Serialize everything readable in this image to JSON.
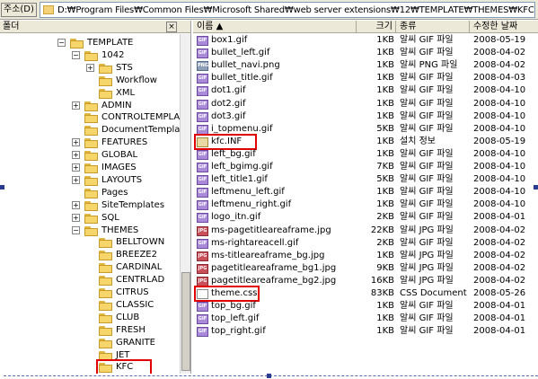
{
  "address_bar": {
    "label": "주소(D)",
    "path": "D:₩Program Files₩Common Files₩Microsoft Shared₩web server extensions₩12₩TEMPLATE₩THEMES₩KFC"
  },
  "folder_pane": {
    "title": "폴더",
    "close_glyph": "×",
    "items": [
      {
        "label": "TEMPLATE",
        "expander": "−",
        "highlighted": false
      },
      {
        "label": "1042",
        "expander": "−",
        "highlighted": false
      },
      {
        "label": "STS",
        "expander": "+",
        "highlighted": false
      },
      {
        "label": "Workflow",
        "expander": "",
        "highlighted": false
      },
      {
        "label": "XML",
        "expander": "",
        "highlighted": false
      },
      {
        "label": "ADMIN",
        "expander": "+",
        "highlighted": false
      },
      {
        "label": "CONTROLTEMPLA",
        "expander": "",
        "highlighted": false
      },
      {
        "label": "DocumentTemplate",
        "expander": "",
        "highlighted": false
      },
      {
        "label": "FEATURES",
        "expander": "+",
        "highlighted": false
      },
      {
        "label": "GLOBAL",
        "expander": "+",
        "highlighted": false
      },
      {
        "label": "IMAGES",
        "expander": "+",
        "highlighted": false
      },
      {
        "label": "LAYOUTS",
        "expander": "+",
        "highlighted": false
      },
      {
        "label": "Pages",
        "expander": "",
        "highlighted": false
      },
      {
        "label": "SiteTemplates",
        "expander": "+",
        "highlighted": false
      },
      {
        "label": "SQL",
        "expander": "+",
        "highlighted": false
      },
      {
        "label": "THEMES",
        "expander": "−",
        "highlighted": false
      },
      {
        "label": "BELLTOWN",
        "expander": "",
        "highlighted": false
      },
      {
        "label": "BREEZE2",
        "expander": "",
        "highlighted": false
      },
      {
        "label": "CARDINAL",
        "expander": "",
        "highlighted": false
      },
      {
        "label": "CENTRLAD",
        "expander": "",
        "highlighted": false
      },
      {
        "label": "CITRUS",
        "expander": "",
        "highlighted": false
      },
      {
        "label": "CLASSIC",
        "expander": "",
        "highlighted": false
      },
      {
        "label": "CLUB",
        "expander": "",
        "highlighted": false
      },
      {
        "label": "FRESH",
        "expander": "",
        "highlighted": false
      },
      {
        "label": "GRANITE",
        "expander": "",
        "highlighted": false
      },
      {
        "label": "JET",
        "expander": "",
        "highlighted": false
      },
      {
        "label": "KFC",
        "expander": "",
        "highlighted": true
      }
    ]
  },
  "file_list": {
    "columns": [
      "이름 ▲",
      "크기",
      "종류",
      "수정한 날짜"
    ],
    "rows": [
      {
        "name": "box1.gif",
        "size": "1KB",
        "type": "알씨 GIF 파일",
        "date": "2008-05-19",
        "icon": "gif",
        "highlighted": false
      },
      {
        "name": "bullet_left.gif",
        "size": "1KB",
        "type": "알씨 GIF 파일",
        "date": "2008-04-02",
        "icon": "gif",
        "highlighted": false
      },
      {
        "name": "bullet_navi.png",
        "size": "1KB",
        "type": "알씨 PNG 파일",
        "date": "2008-04-02",
        "icon": "png",
        "highlighted": false
      },
      {
        "name": "bullet_title.gif",
        "size": "1KB",
        "type": "알씨 GIF 파일",
        "date": "2008-04-03",
        "icon": "gif",
        "highlighted": false
      },
      {
        "name": "dot1.gif",
        "size": "1KB",
        "type": "알씨 GIF 파일",
        "date": "2008-04-10",
        "icon": "gif",
        "highlighted": false
      },
      {
        "name": "dot2.gif",
        "size": "1KB",
        "type": "알씨 GIF 파일",
        "date": "2008-04-10",
        "icon": "gif",
        "highlighted": false
      },
      {
        "name": "dot3.gif",
        "size": "1KB",
        "type": "알씨 GIF 파일",
        "date": "2008-04-10",
        "icon": "gif",
        "highlighted": false
      },
      {
        "name": "i_topmenu.gif",
        "size": "5KB",
        "type": "알씨 GIF 파일",
        "date": "2008-04-10",
        "icon": "gif",
        "highlighted": false
      },
      {
        "name": "kfc.INF",
        "size": "1KB",
        "type": "설치 정보",
        "date": "2008-05-19",
        "icon": "inf",
        "highlighted": true
      },
      {
        "name": "left_bg.gif",
        "size": "1KB",
        "type": "알씨 GIF 파일",
        "date": "2008-04-10",
        "icon": "gif",
        "highlighted": false
      },
      {
        "name": "left_bgimg.gif",
        "size": "7KB",
        "type": "알씨 GIF 파일",
        "date": "2008-04-10",
        "icon": "gif",
        "highlighted": false
      },
      {
        "name": "left_title1.gif",
        "size": "5KB",
        "type": "알씨 GIF 파일",
        "date": "2008-04-10",
        "icon": "gif",
        "highlighted": false
      },
      {
        "name": "leftmenu_left.gif",
        "size": "1KB",
        "type": "알씨 GIF 파일",
        "date": "2008-04-10",
        "icon": "gif",
        "highlighted": false
      },
      {
        "name": "leftmenu_right.gif",
        "size": "1KB",
        "type": "알씨 GIF 파일",
        "date": "2008-04-10",
        "icon": "gif",
        "highlighted": false
      },
      {
        "name": "logo_itn.gif",
        "size": "2KB",
        "type": "알씨 GIF 파일",
        "date": "2008-04-01",
        "icon": "gif",
        "highlighted": false
      },
      {
        "name": "ms-pagetitleareaframe.jpg",
        "size": "22KB",
        "type": "알씨 JPG 파일",
        "date": "2008-04-02",
        "icon": "jpg",
        "highlighted": false
      },
      {
        "name": "ms-rightareacell.gif",
        "size": "2KB",
        "type": "알씨 GIF 파일",
        "date": "2008-04-02",
        "icon": "gif",
        "highlighted": false
      },
      {
        "name": "ms-titleareaframe_bg.jpg",
        "size": "1KB",
        "type": "알씨 JPG 파일",
        "date": "2008-04-02",
        "icon": "jpg",
        "highlighted": false
      },
      {
        "name": "pagetitleareaframe_bg1.jpg",
        "size": "9KB",
        "type": "알씨 JPG 파일",
        "date": "2008-04-02",
        "icon": "jpg",
        "highlighted": false
      },
      {
        "name": "pagetitleareaframe_bg2.jpg",
        "size": "16KB",
        "type": "알씨 JPG 파일",
        "date": "2008-04-02",
        "icon": "jpg",
        "highlighted": false
      },
      {
        "name": "theme.css",
        "size": "83KB",
        "type": "CSS Document",
        "date": "2008-05-26",
        "icon": "css",
        "highlighted": true
      },
      {
        "name": "top_bg.gif",
        "size": "1KB",
        "type": "알씨 GIF 파일",
        "date": "2008-04-01",
        "icon": "gif",
        "highlighted": false
      },
      {
        "name": "top_left.gif",
        "size": "1KB",
        "type": "알씨 GIF 파일",
        "date": "2008-04-01",
        "icon": "gif",
        "highlighted": false
      },
      {
        "name": "top_right.gif",
        "size": "1KB",
        "type": "알씨 GIF 파일",
        "date": "2008-04-01",
        "icon": "gif",
        "highlighted": false
      }
    ]
  },
  "icons": {
    "gif": "GIF",
    "png": "PNG",
    "jpg": "JPG",
    "inf": "",
    "css": ""
  },
  "colors": {
    "highlight_box": "#e00000",
    "folder": "#f6d66b",
    "chrome": "#ece9d8"
  }
}
